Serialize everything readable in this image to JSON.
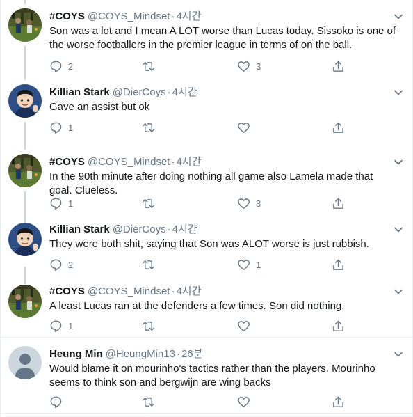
{
  "tweets": [
    {
      "name": "#COYS",
      "handle": "@COYS_Mindset",
      "time": "4시간",
      "avatar": "photo-avatar",
      "text": "Son was a lot and I mean A LOT worse than Lucas today. Sissoko is one of the worse footballers in the premier league in terms of on the ball.",
      "replies": "2",
      "retweets": "",
      "likes": "3"
    },
    {
      "name": "Killian Stark",
      "handle": "@DierCoys",
      "time": "4시간",
      "avatar": "cartoon-avatar",
      "text": "Gave an assist but ok",
      "replies": "1",
      "retweets": "",
      "likes": ""
    },
    {
      "name": "#COYS",
      "handle": "@COYS_Mindset",
      "time": "4시간",
      "avatar": "photo-avatar",
      "text": "In the 90th minute after doing nothing all game also Lamela made that goal. Clueless.",
      "replies": "1",
      "retweets": "",
      "likes": "3"
    },
    {
      "name": "Killian Stark",
      "handle": "@DierCoys",
      "time": "4시간",
      "avatar": "cartoon-avatar",
      "text": "They were both shit, saying that Son was ALOT worse is just rubbish.",
      "replies": "2",
      "retweets": "",
      "likes": "1"
    },
    {
      "name": "#COYS",
      "handle": "@COYS_Mindset",
      "time": "4시간",
      "avatar": "photo-avatar",
      "text": "A least Lucas ran at the defenders a few times. Son did nothing.",
      "replies": "1",
      "retweets": "",
      "likes": ""
    },
    {
      "name": "Heung Min",
      "handle": "@HeungMin13",
      "time": "26분",
      "avatar": "default-avatar",
      "text": "Would blame it on mourinho's tactics rather than the players. Mourinho seems to think son and bergwijn are wing backs",
      "replies": "",
      "retweets": "",
      "likes": ""
    }
  ],
  "separator": "·",
  "colors": {
    "text": "#14171a",
    "muted": "#657786",
    "thread": "#ccd6dd",
    "border": "#e6ecf0"
  }
}
